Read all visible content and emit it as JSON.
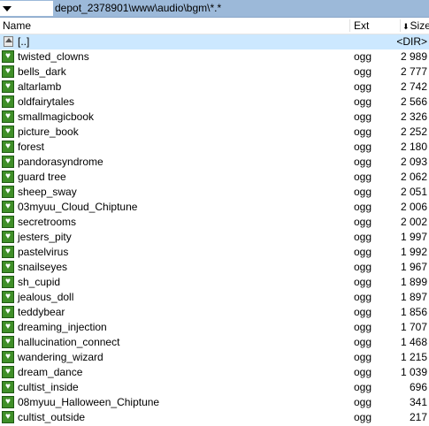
{
  "path_bar": {
    "path": "depot_2378901\\www\\audio\\bgm\\*.*"
  },
  "columns": {
    "name": "Name",
    "ext": "Ext",
    "size": "Size"
  },
  "updir": {
    "label": "[..]",
    "size": "<DIR>"
  },
  "files": [
    {
      "name": "twisted_clowns",
      "ext": "ogg",
      "size": "2 989"
    },
    {
      "name": "bells_dark",
      "ext": "ogg",
      "size": "2 777"
    },
    {
      "name": "altarlamb",
      "ext": "ogg",
      "size": "2 742"
    },
    {
      "name": "oldfairytales",
      "ext": "ogg",
      "size": "2 566"
    },
    {
      "name": "smallmagicbook",
      "ext": "ogg",
      "size": "2 326"
    },
    {
      "name": "picture_book",
      "ext": "ogg",
      "size": "2 252"
    },
    {
      "name": "forest",
      "ext": "ogg",
      "size": "2 180"
    },
    {
      "name": "pandorasyndrome",
      "ext": "ogg",
      "size": "2 093"
    },
    {
      "name": "guard tree",
      "ext": "ogg",
      "size": "2 062"
    },
    {
      "name": "sheep_sway",
      "ext": "ogg",
      "size": "2 051"
    },
    {
      "name": "03myuu_Cloud_Chiptune",
      "ext": "ogg",
      "size": "2 006"
    },
    {
      "name": "secretrooms",
      "ext": "ogg",
      "size": "2 002"
    },
    {
      "name": "jesters_pity",
      "ext": "ogg",
      "size": "1 997"
    },
    {
      "name": "pastelvirus",
      "ext": "ogg",
      "size": "1 992"
    },
    {
      "name": "snailseyes",
      "ext": "ogg",
      "size": "1 967"
    },
    {
      "name": "sh_cupid",
      "ext": "ogg",
      "size": "1 899"
    },
    {
      "name": "jealous_doll",
      "ext": "ogg",
      "size": "1 897"
    },
    {
      "name": "teddybear",
      "ext": "ogg",
      "size": "1 856"
    },
    {
      "name": "dreaming_injection",
      "ext": "ogg",
      "size": "1 707"
    },
    {
      "name": "hallucination_connect",
      "ext": "ogg",
      "size": "1 468"
    },
    {
      "name": "wandering_wizard",
      "ext": "ogg",
      "size": "1 215"
    },
    {
      "name": "dream_dance",
      "ext": "ogg",
      "size": "1 039"
    },
    {
      "name": "cultist_inside",
      "ext": "ogg",
      "size": "696"
    },
    {
      "name": "08myuu_Halloween_Chiptune",
      "ext": "ogg",
      "size": "341"
    },
    {
      "name": "cultist_outside",
      "ext": "ogg",
      "size": "217"
    }
  ]
}
